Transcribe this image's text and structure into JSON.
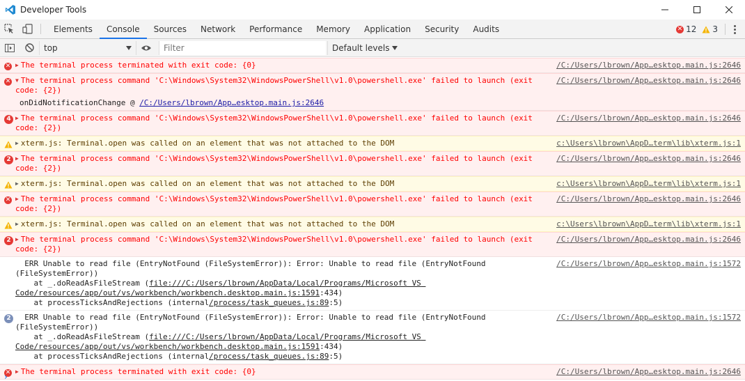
{
  "window": {
    "title": "Developer Tools",
    "minimize": "—",
    "maximize": "☐",
    "close": "✕"
  },
  "tabs": [
    "Elements",
    "Console",
    "Sources",
    "Network",
    "Performance",
    "Memory",
    "Application",
    "Security",
    "Audits"
  ],
  "active_tab": "Console",
  "counts": {
    "errors": "12",
    "warnings": "3"
  },
  "toolbar": {
    "context": "top",
    "filter_placeholder": "Filter",
    "levels": "Default levels"
  },
  "messages": [
    {
      "type": "error",
      "icon": "error-icon",
      "expanded": false,
      "text": "The terminal process terminated with exit code: {0}",
      "source": "/C:/Users/lbrown/App…esktop.main.js:2646"
    },
    {
      "type": "error",
      "icon": "error-icon",
      "expanded": true,
      "text": "The terminal process command 'C:\\Windows\\System32\\WindowsPowerShell\\v1.0\\powershell.exe' failed to launch (exit code: {2})",
      "source": "/C:/Users/lbrown/App…esktop.main.js:2646",
      "sub_text": "onDidNotificationChange @ ",
      "sub_link": "/C:/Users/lbrown/App…esktop.main.js:2646"
    },
    {
      "type": "error",
      "icon": "count-badge",
      "count": "4",
      "expanded": false,
      "text": "The terminal process command 'C:\\Windows\\System32\\WindowsPowerShell\\v1.0\\powershell.exe' failed to launch (exit code: {2})",
      "source": "/C:/Users/lbrown/App…esktop.main.js:2646"
    },
    {
      "type": "warn",
      "icon": "warning-icon",
      "expanded": false,
      "text": "xterm.js: Terminal.open was called on an element that was not attached to the DOM",
      "source": "c:\\Users\\lbrown\\AppD…term\\lib\\xterm.js:1"
    },
    {
      "type": "error",
      "icon": "count-badge",
      "count": "2",
      "expanded": false,
      "text": "The terminal process command 'C:\\Windows\\System32\\WindowsPowerShell\\v1.0\\powershell.exe' failed to launch (exit code: {2})",
      "source": "/C:/Users/lbrown/App…esktop.main.js:2646"
    },
    {
      "type": "warn",
      "icon": "warning-icon",
      "expanded": false,
      "text": "xterm.js: Terminal.open was called on an element that was not attached to the DOM",
      "source": "c:\\Users\\lbrown\\AppD…term\\lib\\xterm.js:1"
    },
    {
      "type": "error",
      "icon": "error-icon",
      "expanded": false,
      "text": "The terminal process command 'C:\\Windows\\System32\\WindowsPowerShell\\v1.0\\powershell.exe' failed to launch (exit code: {2})",
      "source": "/C:/Users/lbrown/App…esktop.main.js:2646"
    },
    {
      "type": "warn",
      "icon": "warning-icon",
      "expanded": false,
      "text": "xterm.js: Terminal.open was called on an element that was not attached to the DOM",
      "source": "c:\\Users\\lbrown\\AppD…term\\lib\\xterm.js:1"
    },
    {
      "type": "error",
      "icon": "count-badge",
      "count": "2",
      "expanded": false,
      "text": "The terminal process command 'C:\\Windows\\System32\\WindowsPowerShell\\v1.0\\powershell.exe' failed to launch (exit code: {2})",
      "source": "/C:/Users/lbrown/App…esktop.main.js:2646"
    },
    {
      "type": "plain",
      "icon": "none",
      "text": "  ERR Unable to read file (EntryNotFound (FileSystemError)): Error: Unable to read file (EntryNotFound (FileSystemError))",
      "source": "/C:/Users/lbrown/App…esktop.main.js:1572",
      "stack": [
        {
          "pre": "    at _.doReadAsFileStream (",
          "link": "file:///C:/Users/lbrown/AppData/Local/Programs/Microsoft VS Code/resources/app/out/vs/workbench/workbench.desktop.main.js:1591",
          "post": ":434)"
        },
        {
          "pre": "    at processTicksAndRejections (internal",
          "link": "/process/task_queues.js:89",
          "post": ":5)"
        }
      ]
    },
    {
      "type": "plain",
      "icon": "count-badge-blue",
      "count": "2",
      "text": "  ERR Unable to read file (EntryNotFound (FileSystemError)): Error: Unable to read file (EntryNotFound (FileSystemError))",
      "source": "/C:/Users/lbrown/App…esktop.main.js:1572",
      "stack": [
        {
          "pre": "    at _.doReadAsFileStream (",
          "link": "file:///C:/Users/lbrown/AppData/Local/Programs/Microsoft VS Code/resources/app/out/vs/workbench/workbench.desktop.main.js:1591",
          "post": ":434)"
        },
        {
          "pre": "    at processTicksAndRejections (internal",
          "link": "/process/task_queues.js:89",
          "post": ":5)"
        }
      ]
    },
    {
      "type": "error",
      "icon": "error-icon",
      "expanded": false,
      "text": "The terminal process terminated with exit code: {0}",
      "source": "/C:/Users/lbrown/App…esktop.main.js:2646"
    }
  ],
  "prompt": "›",
  "colors": {
    "error": "#ff0000",
    "error_bg": "#fff0f0",
    "warn_bg": "#fffbe5",
    "accent": "#1a73e8"
  }
}
